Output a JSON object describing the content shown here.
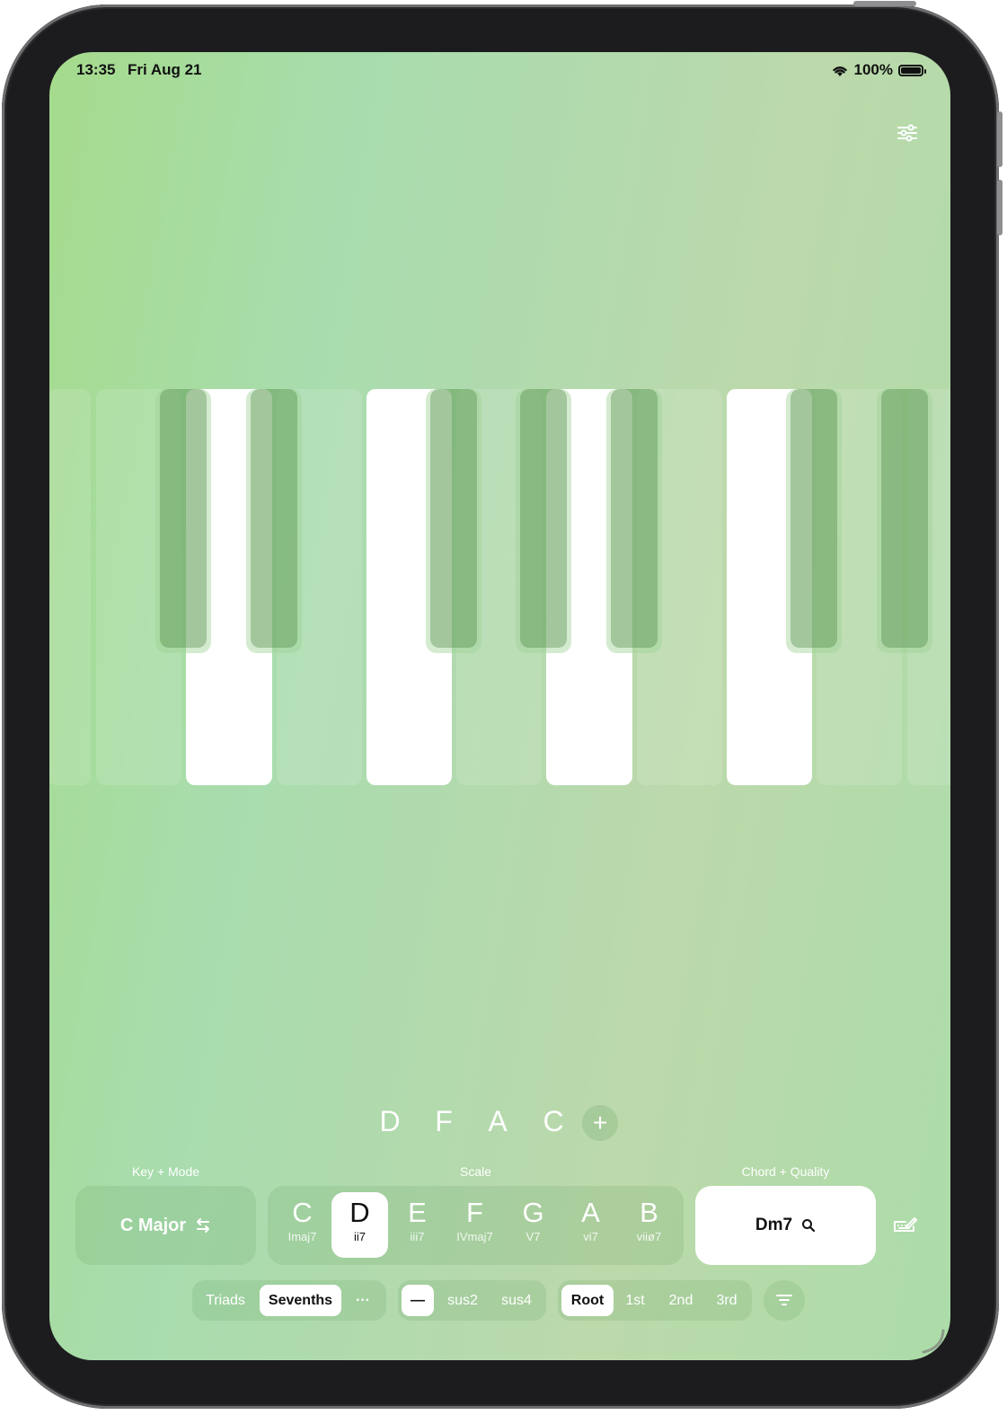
{
  "status_bar": {
    "time": "13:35",
    "date": "Fri Aug 21",
    "battery": "100%"
  },
  "keyboard": {
    "highlighted_notes": [
      "D",
      "F",
      "A",
      "C"
    ]
  },
  "chord_notes": [
    "D",
    "F",
    "A",
    "C"
  ],
  "add_note_label": "+",
  "key_mode": {
    "caption": "Key + Mode",
    "value": "C Major"
  },
  "scale": {
    "caption": "Scale",
    "selected": "D",
    "degrees": [
      {
        "note": "C",
        "roman": "Imaj7"
      },
      {
        "note": "D",
        "roman": "ii7"
      },
      {
        "note": "E",
        "roman": "iii7"
      },
      {
        "note": "F",
        "roman": "IVmaj7"
      },
      {
        "note": "G",
        "roman": "V7"
      },
      {
        "note": "A",
        "roman": "vi7"
      },
      {
        "note": "B",
        "roman": "viiø7"
      }
    ]
  },
  "chord_quality": {
    "caption": "Chord + Quality",
    "value": "Dm7"
  },
  "chord_type": {
    "options": [
      "Triads",
      "Sevenths",
      "···"
    ],
    "selected": "Sevenths"
  },
  "suspension": {
    "options": [
      "—",
      "sus2",
      "sus4"
    ],
    "selected": "—"
  },
  "inversion": {
    "options": [
      "Root",
      "1st",
      "2nd",
      "3rd"
    ],
    "selected": "Root"
  },
  "icons": {
    "settings": "sliders-icon",
    "swap": "swap-arrows-icon",
    "search": "search-icon",
    "edit": "pencil-keyboard-icon",
    "filter": "filter-lines-icon",
    "wifi": "wifi-icon",
    "battery": "battery-icon"
  }
}
